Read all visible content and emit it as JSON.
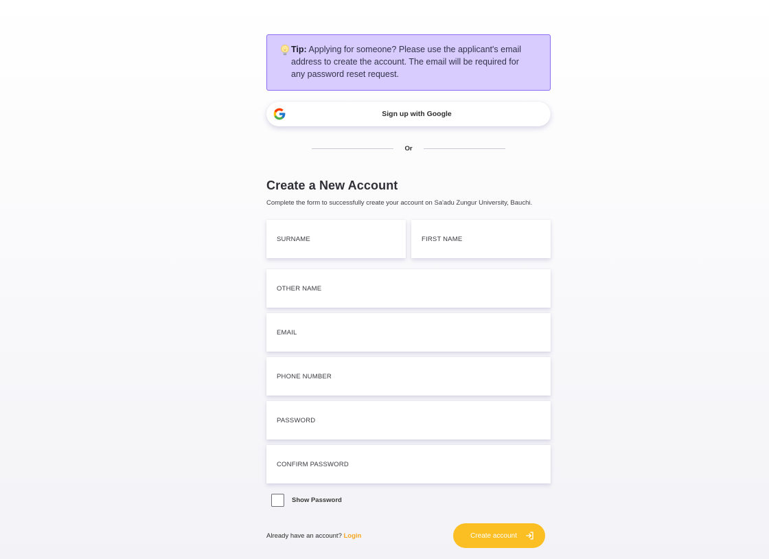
{
  "tip": {
    "label": "Tip:",
    "message": "Applying for someone? Please use the applicant's email address to create the account. The email will be required for any password reset request.",
    "icon": "lightbulb-icon"
  },
  "google": {
    "label": "Sign up with Google",
    "icon": "google-icon"
  },
  "divider": {
    "text": "Or"
  },
  "form": {
    "title": "Create a New Account",
    "subtitle": "Complete the form to successfully create your account on Sa'adu Zungur University, Bauchi.",
    "fields": {
      "surname": {
        "placeholder": "SURNAME",
        "value": ""
      },
      "first_name": {
        "placeholder": "FIRST NAME",
        "value": ""
      },
      "other_name": {
        "placeholder": "OTHER NAME",
        "value": ""
      },
      "email": {
        "placeholder": "EMAIL",
        "value": ""
      },
      "phone": {
        "placeholder": "PHONE NUMBER",
        "value": ""
      },
      "password": {
        "placeholder": "PASSWORD",
        "value": ""
      },
      "confirm_password": {
        "placeholder": "CONFIRM PASSWORD",
        "value": ""
      }
    },
    "show_password": {
      "label": "Show Password",
      "checked": false
    }
  },
  "footer": {
    "have_account": "Already have an account?",
    "login_link": "Login",
    "create_button": "Create account",
    "create_icon": "sign-in-arrow-icon"
  },
  "colors": {
    "tip_bg": "#d7ccfd",
    "tip_border": "#8b6cf2",
    "accent": "#fbbf24",
    "link": "#f5a623"
  }
}
